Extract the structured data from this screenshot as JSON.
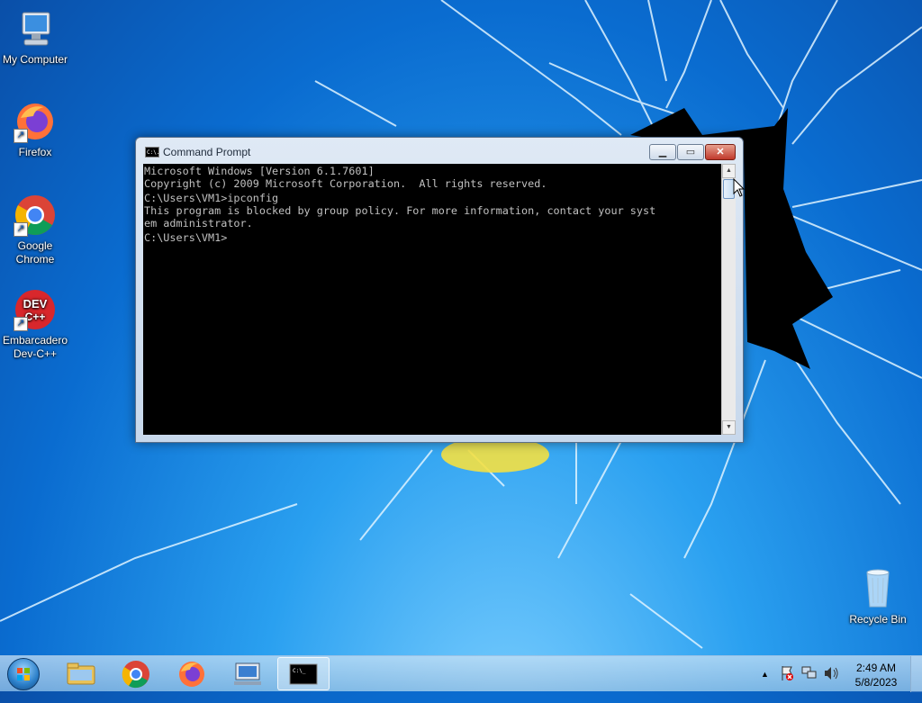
{
  "desktop": {
    "icons": [
      {
        "label": "My Computer"
      },
      {
        "label": "Firefox"
      },
      {
        "label": "Google Chrome"
      },
      {
        "label": "Embarcadero Dev-C++"
      },
      {
        "label": "Recycle Bin"
      }
    ],
    "devcpp_logo_text": "DEV C++"
  },
  "window": {
    "title": "Command Prompt",
    "icon_text": "C:\\.",
    "console_lines": [
      "Microsoft Windows [Version 6.1.7601]",
      "Copyright (c) 2009 Microsoft Corporation.  All rights reserved.",
      "",
      "C:\\Users\\VM1>ipconfig",
      "This program is blocked by group policy. For more information, contact your syst",
      "em administrator.",
      "",
      "C:\\Users\\VM1>"
    ]
  },
  "taskbar": {
    "cmd_thumb_text": "C:\\_",
    "clock": {
      "time": "2:49 AM",
      "date": "5/8/2023"
    }
  },
  "colors": {
    "desktop_bg": "#0a6cd0",
    "console_bg": "#000000",
    "console_text": "#c0c0c0",
    "close_button": "#c0392b"
  }
}
